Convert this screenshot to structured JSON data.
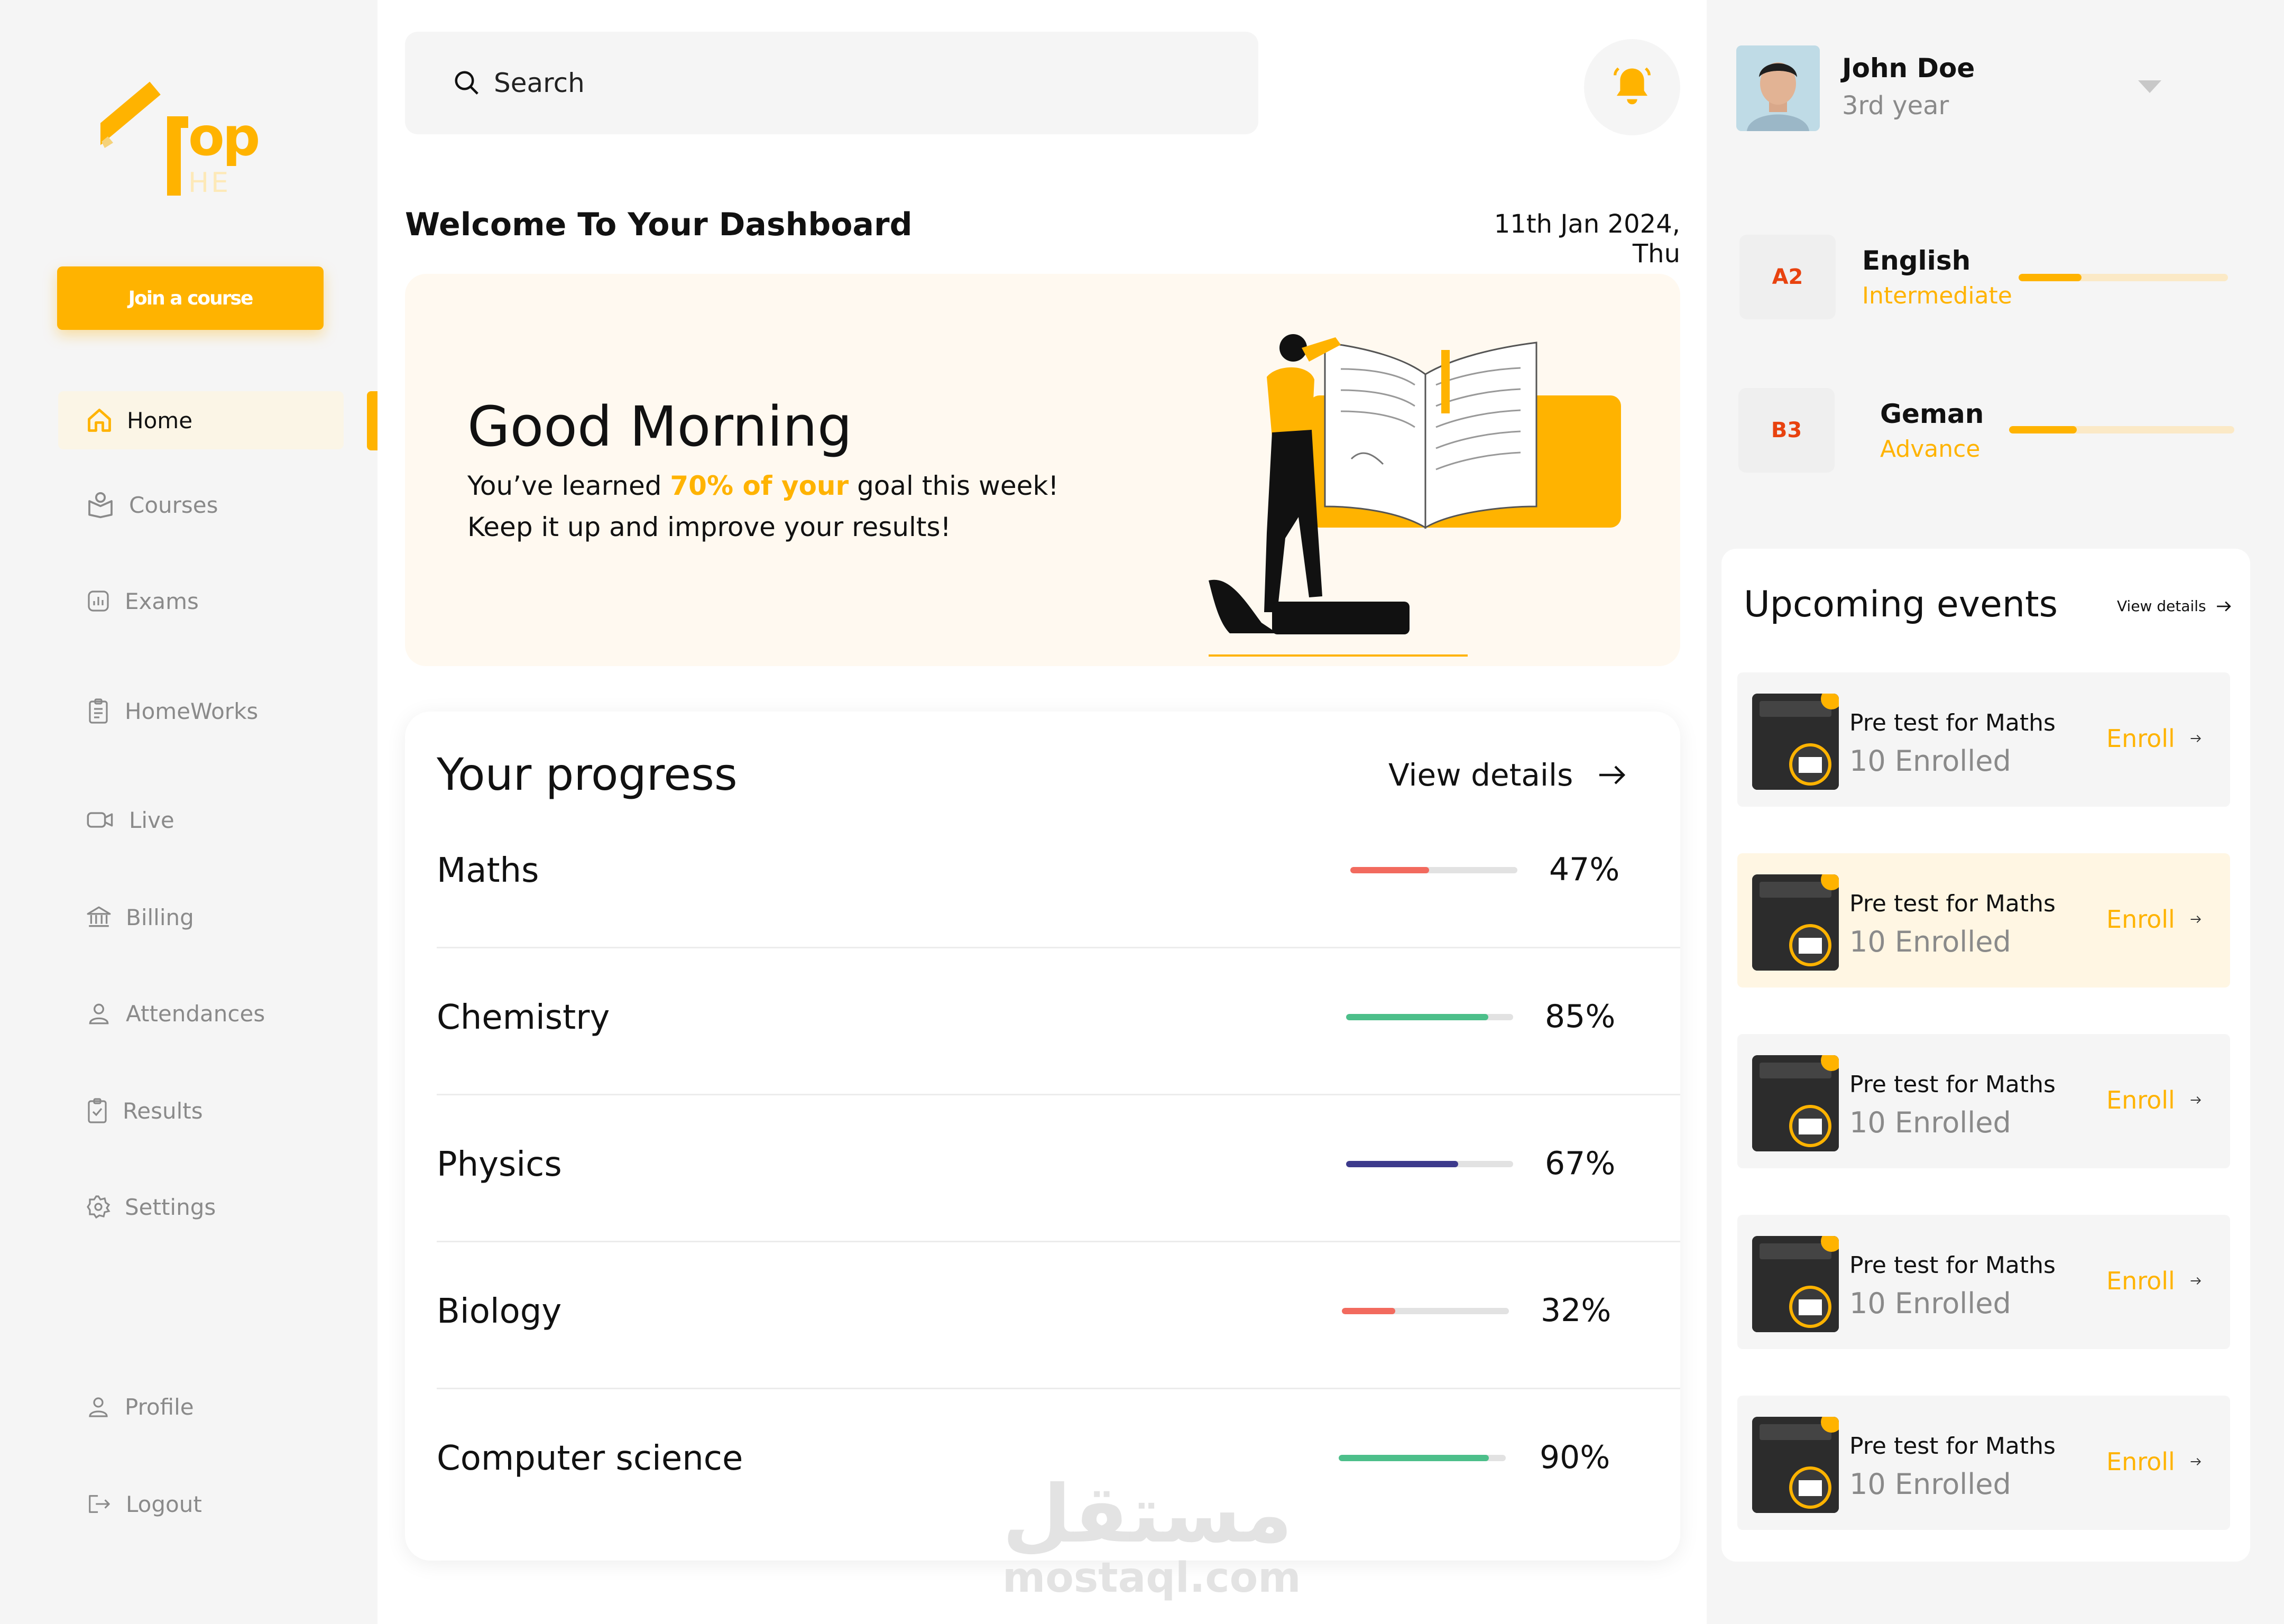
{
  "brand": {
    "logo_text": "op",
    "logo_sub": "HE"
  },
  "sidebar": {
    "join_label": "Join a course",
    "items": [
      {
        "label": "Home",
        "icon": "home-icon",
        "active": true
      },
      {
        "label": "Courses",
        "icon": "courses-icon"
      },
      {
        "label": "Exams",
        "icon": "exams-icon"
      },
      {
        "label": "HomeWorks",
        "icon": "homeworks-icon"
      },
      {
        "label": "Live",
        "icon": "live-icon"
      },
      {
        "label": "Billing",
        "icon": "billing-icon"
      },
      {
        "label": "Attendances",
        "icon": "attendances-icon"
      },
      {
        "label": "Results",
        "icon": "results-icon"
      },
      {
        "label": "Settings",
        "icon": "settings-icon"
      }
    ],
    "bottom": [
      {
        "label": "Profile",
        "icon": "profile-icon"
      },
      {
        "label": "Logout",
        "icon": "logout-icon"
      }
    ]
  },
  "search": {
    "placeholder": "Search"
  },
  "header": {
    "welcome": "Welcome To Your Dashboard",
    "date": "11th Jan 2024, Thu"
  },
  "hero": {
    "greeting": "Good Morning",
    "line1_pre": "You’ve learned ",
    "line1_highlight": "70% of your",
    "line1_post": " goal this week!",
    "line2": "Keep it up and improve your results!"
  },
  "progress": {
    "title": "Your progress",
    "view_details": "View details",
    "subjects": [
      {
        "name": "Maths",
        "percent_label": "47%",
        "value": 0.47,
        "color": "#f26a5e"
      },
      {
        "name": "Chemistry",
        "percent_label": "85%",
        "value": 0.85,
        "color": "#4cbf8a"
      },
      {
        "name": "Physics",
        "percent_label": "67%",
        "value": 0.67,
        "color": "#3d3a8c"
      },
      {
        "name": "Biology",
        "percent_label": "32%",
        "value": 0.32,
        "color": "#f26a5e"
      },
      {
        "name": "Computer science",
        "percent_label": "90%",
        "value": 0.9,
        "color": "#4cbf8a"
      }
    ]
  },
  "user": {
    "name": "John Doe",
    "year": "3rd year"
  },
  "languages": [
    {
      "level": "A2",
      "name": "English",
      "sub": "Intermediate",
      "value": 0.3
    },
    {
      "level": "B3",
      "name": "Geman",
      "sub": "Advance",
      "value": 0.3
    }
  ],
  "events": {
    "title": "Upcoming events",
    "view_details": "View details",
    "items": [
      {
        "name": "Pre test for Maths",
        "count": "10 Enrolled",
        "action": "Enroll",
        "highlight": false
      },
      {
        "name": "Pre test for Maths",
        "count": "10 Enrolled",
        "action": "Enroll",
        "highlight": true
      },
      {
        "name": "Pre test for Maths",
        "count": "10 Enrolled",
        "action": "Enroll",
        "highlight": false
      },
      {
        "name": "Pre test for Maths",
        "count": "10 Enrolled",
        "action": "Enroll",
        "highlight": false
      },
      {
        "name": "Pre test for Maths",
        "count": "10 Enrolled",
        "action": "Enroll",
        "highlight": false
      }
    ]
  },
  "watermark": {
    "arabic": "مستقل",
    "latin": "mostaql.com"
  },
  "colors": {
    "accent": "#ffb300",
    "level_text": "#e8420f"
  }
}
